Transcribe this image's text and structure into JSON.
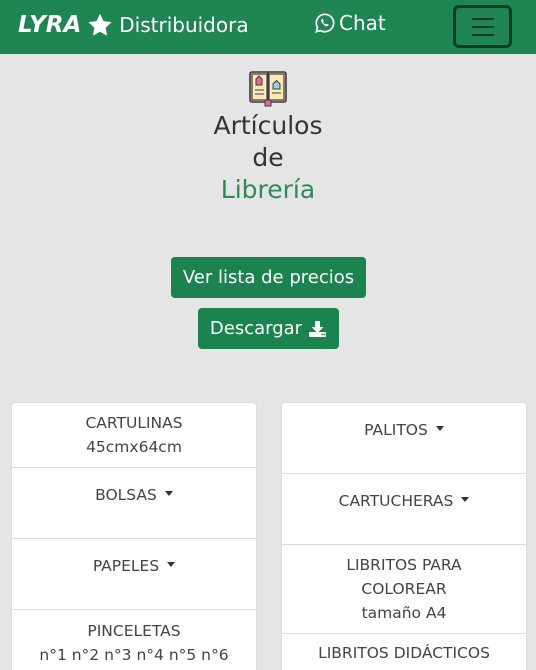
{
  "navbar": {
    "logo_text": "LYRA",
    "brand_name": "Distribuidora",
    "chat_label": "Chat",
    "icons": {
      "star": "star-icon",
      "chat": "whatsapp-icon",
      "menu": "hamburger-menu-icon"
    },
    "colors": {
      "background": "#1e8553",
      "text": "#ffffff"
    }
  },
  "hero": {
    "icon": "book-icon",
    "title_line1": "Artículos",
    "title_line2": "de",
    "title_line3": "Librería",
    "accent_color": "#2e8a5d"
  },
  "actions": {
    "prices_label": "Ver lista de precios",
    "download_label": "Descargar",
    "download_icon": "download-icon",
    "button_color": "#1b8350"
  },
  "categories": {
    "left": [
      {
        "label": "CARTULINAS",
        "sub": "45cmx64cm",
        "dropdown": false
      },
      {
        "label": "BOLSAS",
        "dropdown": true
      },
      {
        "label": "PAPELES",
        "dropdown": true
      },
      {
        "label": "PINCELETAS",
        "sub": "n°1 n°2 n°3 n°4 n°5 n°6",
        "dropdown": false
      }
    ],
    "right": [
      {
        "label": "PALITOS",
        "dropdown": true
      },
      {
        "label": "CARTUCHERAS",
        "dropdown": true
      },
      {
        "label": "LIBRITOS PARA",
        "label2": "COLOREAR",
        "sub": "tamaño A4",
        "dropdown": false
      },
      {
        "label": "LIBRITOS DIDÁCTICOS",
        "dropdown": false
      }
    ]
  }
}
